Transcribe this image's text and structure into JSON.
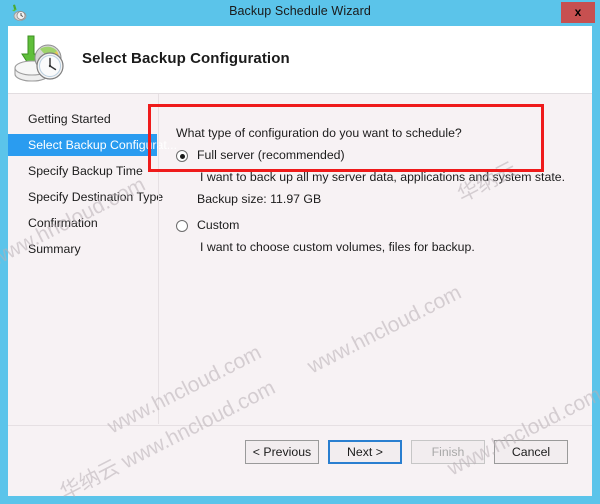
{
  "window": {
    "title": "Backup Schedule Wizard",
    "title_icon": "backup-schedule-icon",
    "close_label": "x",
    "frame_color": "#5bc4ea",
    "close_color": "#c75050"
  },
  "header": {
    "title": "Select Backup Configuration",
    "icon": "backup-disk-clock-icon"
  },
  "sidebar": {
    "items": [
      {
        "label": "Getting Started",
        "selected": false
      },
      {
        "label": "Select Backup Configurat...",
        "selected": true
      },
      {
        "label": "Specify Backup Time",
        "selected": false
      },
      {
        "label": "Specify Destination Type",
        "selected": false
      },
      {
        "label": "Confirmation",
        "selected": false
      },
      {
        "label": "Summary",
        "selected": false
      }
    ],
    "selected_color": "#2a9cf0"
  },
  "content": {
    "question": "What type of configuration do you want to schedule?",
    "options": [
      {
        "label": "Full server (recommended)",
        "selected": true,
        "description": "I want to back up all my server data, applications and system state.",
        "detail": "Backup size: 11.97 GB"
      },
      {
        "label": "Custom",
        "selected": false,
        "description": "I want to choose custom volumes, files for backup.",
        "detail": ""
      }
    ]
  },
  "footer": {
    "buttons": [
      {
        "label": "< Previous",
        "state": "enabled"
      },
      {
        "label": "Next >",
        "state": "focused"
      },
      {
        "label": "Finish",
        "state": "disabled"
      },
      {
        "label": "Cancel",
        "state": "enabled"
      }
    ]
  },
  "annotation": {
    "color": "#ef1b1b",
    "shape": "rectangle-highlight"
  },
  "watermarks": {
    "latin": "www.hncloud.com",
    "cjk": "华纳云",
    "cjk_latin": "华纳云 www.hncloud.com"
  }
}
